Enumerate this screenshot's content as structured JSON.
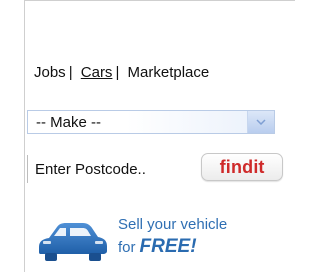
{
  "nav": {
    "jobs": "Jobs",
    "separator": "|",
    "cars": "Cars",
    "marketplace": "Marketplace"
  },
  "make_select": {
    "selected": "-- Make --"
  },
  "postcode": {
    "placeholder": "Enter Postcode.."
  },
  "findit": {
    "label_a": "find",
    "label_b": "it"
  },
  "sell_banner": {
    "line1": "Sell your vehicle",
    "line2_for": "for",
    "line2_free": "FREE!"
  },
  "icons": {
    "car": "car-icon",
    "dropdown": "chevron-down-icon"
  },
  "colors": {
    "brand_red": "#cf2a2a",
    "link_blue": "#2f6fb3",
    "select_blue": "#b9cdee"
  }
}
